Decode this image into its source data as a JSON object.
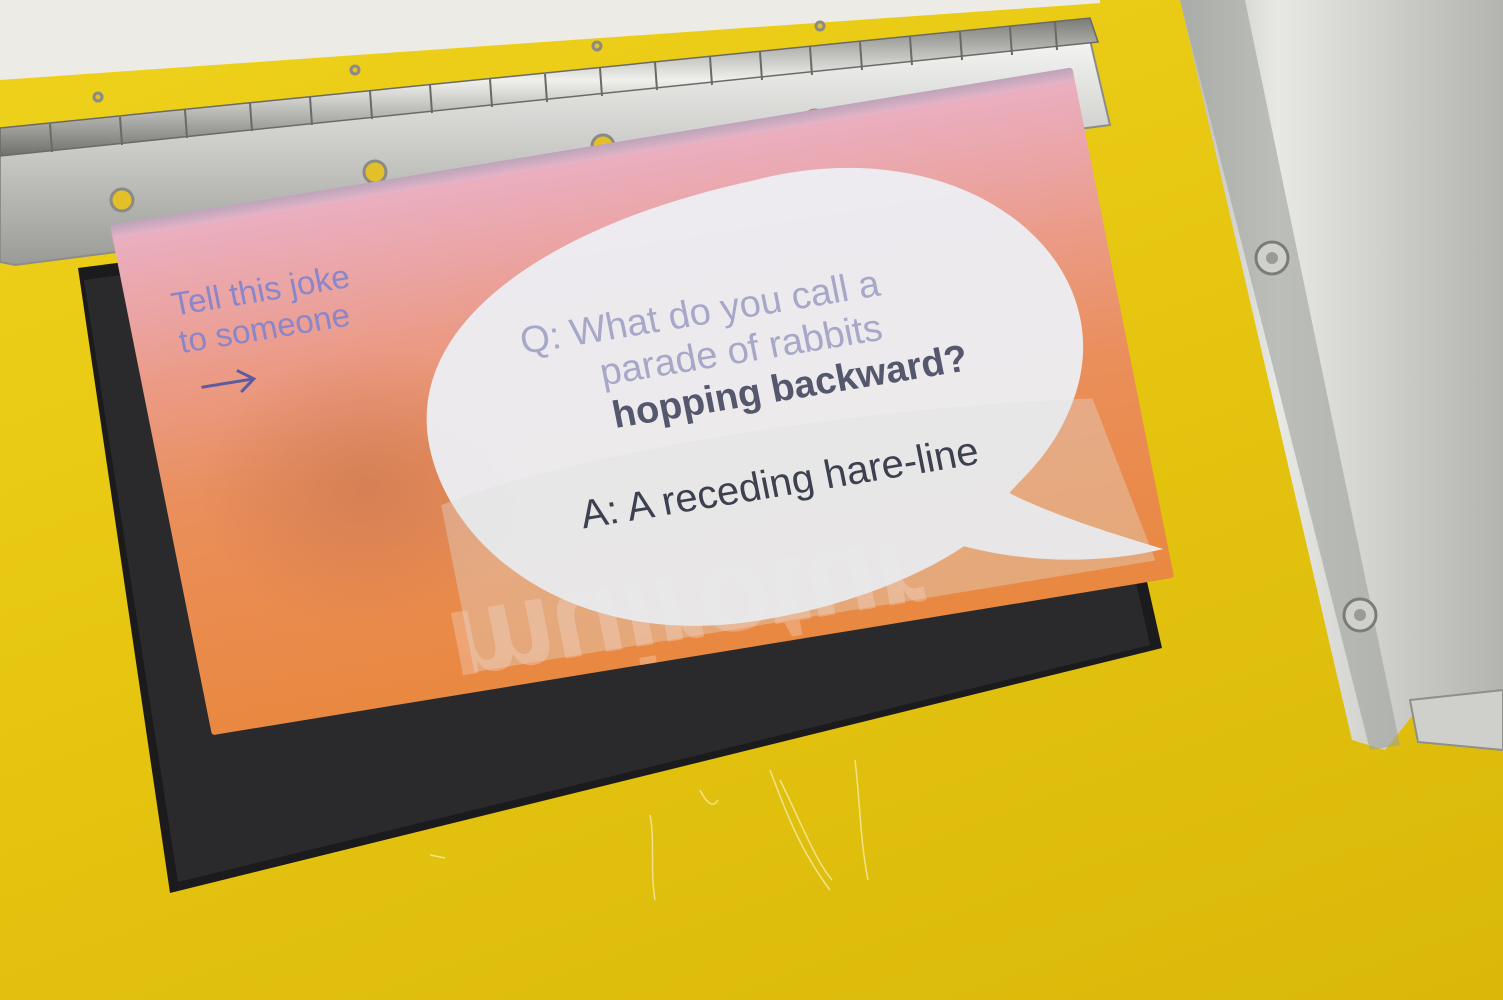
{
  "screen": {
    "prompt_line1": "Tell this joke",
    "prompt_line2": "to someone",
    "question_line1": "Q: What do you call a",
    "question_line2": "parade of rabbits",
    "question_line3": "hopping backward?",
    "answer": "A: A receding hare-line",
    "watermark": "muirotur"
  },
  "colors": {
    "panel_yellow": "#e6c610",
    "screen_pink": "#e69fb7",
    "screen_orange": "#e98840",
    "prompt_text": "#8a86c9",
    "bubble": "#ecedf2"
  },
  "icons": {
    "arrow": "right-arrow-icon"
  }
}
